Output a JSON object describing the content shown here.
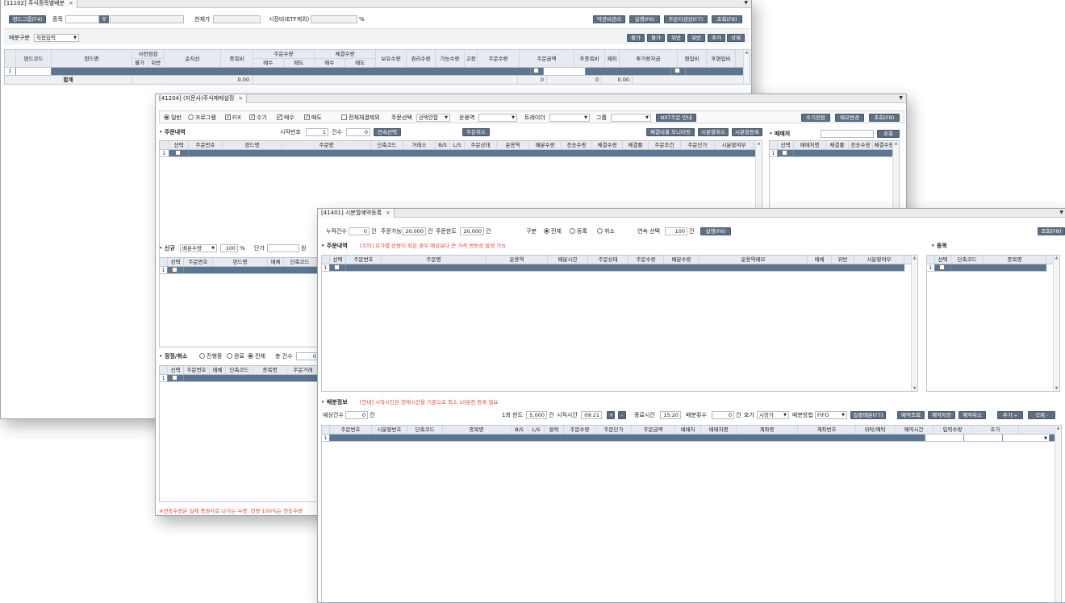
{
  "w1": {
    "tab": "[11102] 주식종목별배분",
    "close": "×",
    "fund_group_btn": "펀드그룹(F4)",
    "stock_label": "종목",
    "price_label": "현재가",
    "mktcap_label": "시장비(ETF제외)",
    "pct": "%",
    "btns": [
      "약관비관리",
      "실행(F6)",
      "주문지생성(F7)",
      "조회(F8)"
    ],
    "dist_label": "배분구분",
    "dist_value": "직접입력",
    "small_btns": [
      "불가",
      "불가",
      "위반",
      "위반",
      "추가",
      "삭제"
    ],
    "headers": [
      "펀드코드",
      "펀드명",
      "사전점검 불가",
      "위반",
      "순자산",
      "종목비",
      "주문수량 매수",
      "매도",
      "체결수량 매수",
      "매도",
      "보유수량",
      "권리수량",
      "가능수량",
      "고정",
      "주문수량",
      "주문금액",
      "후종목비",
      "제외",
      "투가용자금",
      "편입비",
      "후편입비"
    ],
    "top_headers": [
      "사전점검",
      "주문수량",
      "체결수량"
    ],
    "sub_headers": [
      "불가",
      "위반",
      "매수",
      "매도",
      "매수",
      "매도"
    ],
    "sum_label": "합계",
    "sum_net": "0.00",
    "sum_qty": "0",
    "sum_amt": "0",
    "sum_after": "0.00"
  },
  "w2": {
    "tab": "[41204] (자문사)주식매매설정",
    "close": "×",
    "mode_general": "일반",
    "mode_program": "프로그램",
    "fix": "FIX",
    "manual": "수기",
    "buy": "매수",
    "sell": "매도",
    "all_exec_exclude": "전체체결제외",
    "order_select_label": "주문선택",
    "order_select_value": "선택안함",
    "operator_label": "운용역",
    "trader_label": "트레이더",
    "group_label": "그룹",
    "nxt_btn": "NXT주문 안내",
    "manual_btn": "수기전환",
    "memo_btn": "메모변경",
    "query_btn": "조회(F8)",
    "order_section": "주문내역",
    "start_no_label": "시작번호",
    "start_no": "1",
    "count_label": "건수",
    "count": "0",
    "cont_btn": "연속선택",
    "cancel_btn": "주문취소",
    "monitor_btn": "체결비율 모니터링",
    "split_btn": "시분할취소",
    "split_reg_btn": "시분할등록",
    "broker_section": "매매처",
    "broker_query_btn": "조회",
    "order_headers": [
      "선택",
      "주문번호",
      "펀드명",
      "주문명",
      "단축코드",
      "거래소",
      "B/S",
      "L/S",
      "주문상태",
      "운용역",
      "배분수량",
      "전송수량",
      "체결수량",
      "체결률",
      "주문조건",
      "주문단가",
      "시분할여부"
    ],
    "broker_headers": [
      "선택",
      "매매처명",
      "체결률",
      "전송수량",
      "체결수량"
    ],
    "new_label": "신규",
    "new_select": "배분수량",
    "new_pct": "100",
    "new_pct_unit": "%",
    "unit_price_label": "단가",
    "won": "원",
    "new_headers": [
      "선택",
      "주문번호",
      "펀드명",
      "매체",
      "단축코드"
    ],
    "mod_label": "정정/취소",
    "mod_opts": [
      "진행중",
      "완료",
      "전체"
    ],
    "total_count_label": "총 건수",
    "total_count": "0",
    "mod_headers": [
      "선택",
      "주문번호",
      "매체",
      "단축코드",
      "종목명",
      "주문거래"
    ],
    "footnote": "※전송수량은 실제 증권사로 나가는 수량. 전량 100%는 전송수량"
  },
  "w3": {
    "tab": "[41401] 시분할예약등록",
    "close": "×",
    "acc_count_label": "누적건수",
    "acc_count": "0",
    "unit_gun": "건",
    "order_avail_label": "주문가능",
    "order_avail": "20,000",
    "order_limit_label": "주문한도",
    "order_limit": "20,000",
    "div_label": "구분",
    "div_opts": [
      "전체",
      "등록",
      "취소"
    ],
    "cont_select_label": "연속 선택",
    "cont_select": "100",
    "run_btn": "실행(F6)",
    "query_btn": "조회(F8)",
    "order_section": "주문내역",
    "order_note": "[주의] 호가별 잔량이 작은 경우 예상보다 큰 가격 변동성 발생 가능",
    "stock_section": "종목",
    "order_headers": [
      "선택",
      "주문번호",
      "주문명",
      "운용역",
      "배분시간",
      "주문상태",
      "주문수량",
      "배분수량",
      "운용역메모",
      "매체",
      "위반",
      "시분할여부"
    ],
    "stock_headers": [
      "선택",
      "단축코드",
      "종목명"
    ],
    "alloc_section": "배분정보",
    "alloc_note": "[안내] 시작시간은 현재시간을 기준으로 최소 10분전 등록 필요",
    "exp_count_label": "예상건수",
    "exp_count": "0",
    "once_limit_label": "1회 한도",
    "once_limit": "5,000",
    "start_time_label": "시작시간",
    "start_time": "09:21",
    "plus": "+",
    "minus": "-",
    "end_time_label": "종료시간",
    "end_time": "15:20",
    "alloc_cnt_label": "배분횟수",
    "alloc_cnt": "0",
    "quote_label": "호가",
    "quote_value": "시장가",
    "method_label": "배분방법",
    "method_value": "FIFO",
    "batch_btn": "일괄배분(F7)",
    "res_query_btn": "예약조회",
    "res_save_btn": "예약저장",
    "res_cancel_btn": "예약취소",
    "add_btn": "추가",
    "del_btn": "삭제",
    "alloc_headers": [
      "주문번호",
      "시분할번호",
      "단축코드",
      "종목명",
      "B/S",
      "L/S",
      "블럭",
      "주문수량",
      "주문단가",
      "주문금액",
      "매매처",
      "매매처명",
      "계좌명",
      "계좌번호",
      "위탁/예탁",
      "예약시간",
      "입력수량",
      "호가"
    ]
  }
}
